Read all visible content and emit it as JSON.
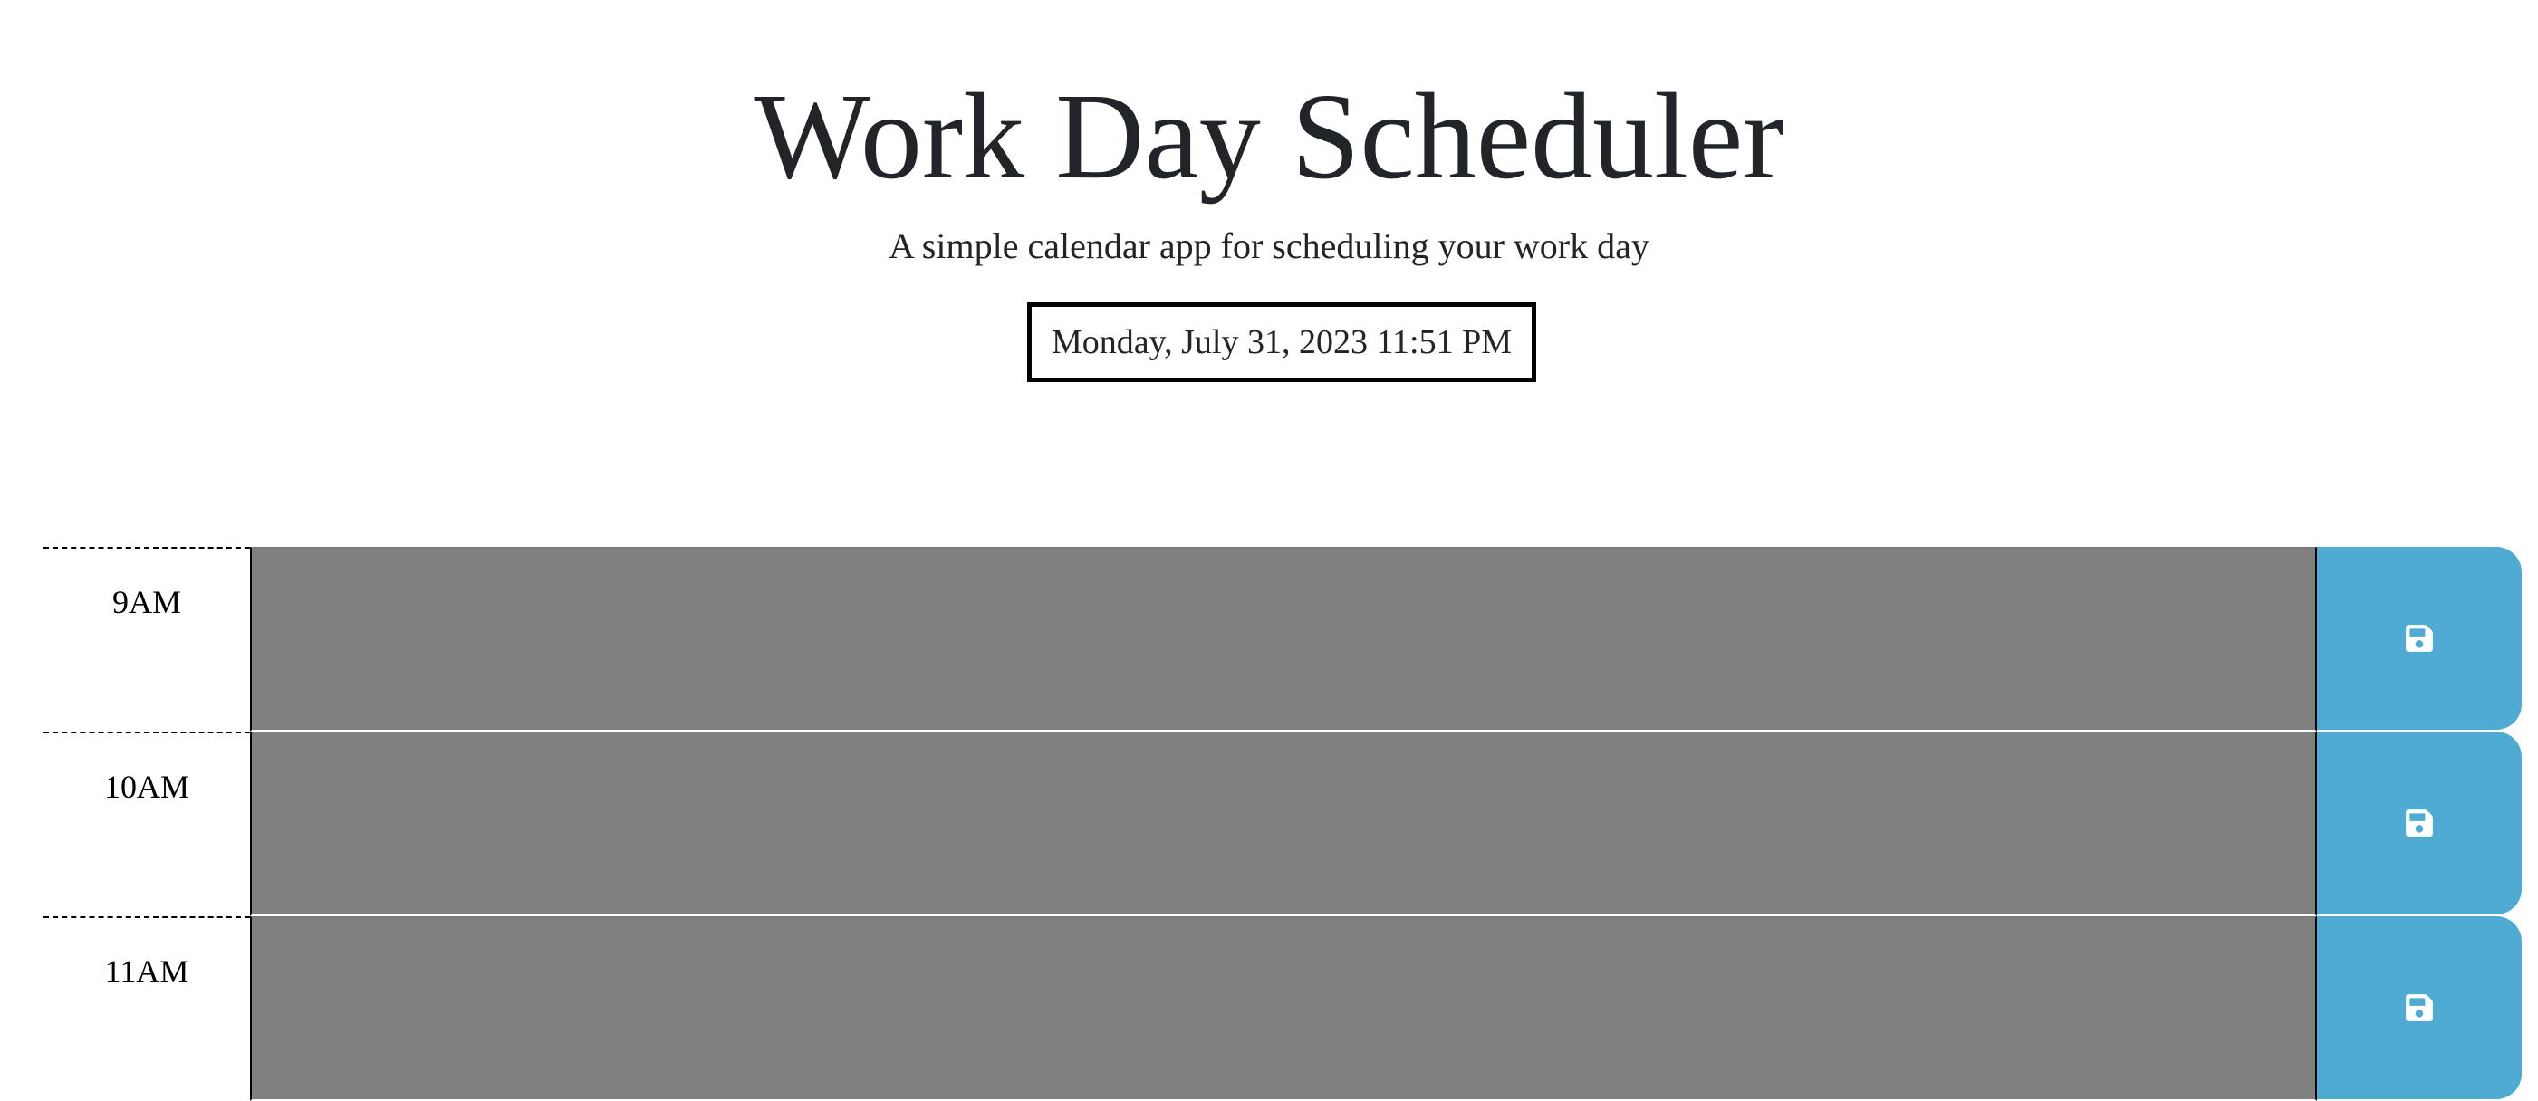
{
  "header": {
    "title": "Work Day Scheduler",
    "subtitle": "A simple calendar app for scheduling your work day",
    "current_day": "Monday, July 31, 2023 11:51 PM"
  },
  "timeblocks": [
    {
      "hour": "9AM",
      "description": "",
      "status": "past",
      "save_icon": "floppy-disk-icon"
    },
    {
      "hour": "10AM",
      "description": "",
      "status": "past",
      "save_icon": "floppy-disk-icon"
    },
    {
      "hour": "11AM",
      "description": "",
      "status": "past",
      "save_icon": "floppy-disk-icon"
    }
  ],
  "colors": {
    "past": "#808080",
    "save_button": "#4eabd3",
    "icon": "#ffffff",
    "text": "#212529"
  }
}
